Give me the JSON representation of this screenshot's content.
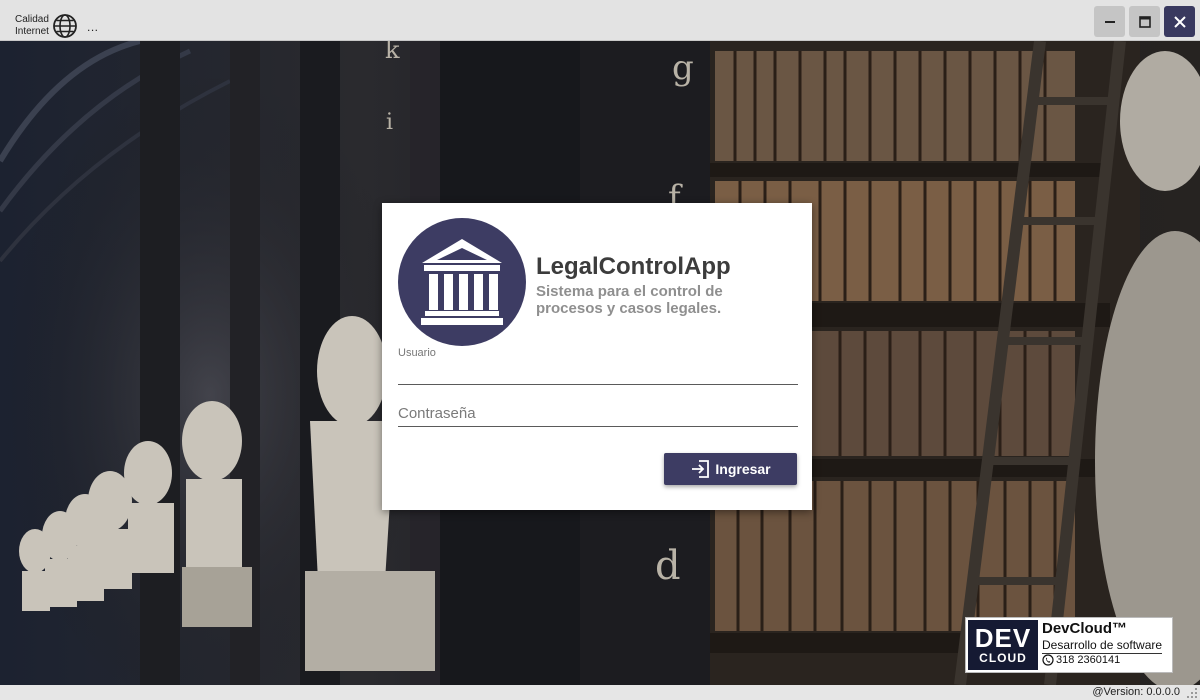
{
  "titlebar": {
    "network_label_line1": "Calidad",
    "network_label_line2": "Internet",
    "menu_dots": "...",
    "minimize_icon": "minimize-icon",
    "maximize_icon": "maximize-icon",
    "close_icon": "close-icon",
    "close_color": "#39395f"
  },
  "background": {
    "shelf_letters": [
      "k",
      "i",
      "g",
      "f",
      "d"
    ]
  },
  "login": {
    "app_name": "LegalControlApp",
    "subtitle": "Sistema para el control de procesos y casos legales.",
    "username_label": "Usuario",
    "username_value": "",
    "password_placeholder": "Contraseña",
    "submit_label": "Ingresar",
    "accent_color": "#3d3c63",
    "logo_icon": "courthouse-icon",
    "submit_icon": "login-icon"
  },
  "badge": {
    "logo_line1": "DEV",
    "logo_line2": "CLOUD",
    "name": "DevCloud™",
    "tagline": "Desarrollo de software",
    "phone": "318 2360141",
    "phone_icon": "whatsapp-icon"
  },
  "statusbar": {
    "version": "@Version: 0.0.0.0"
  }
}
